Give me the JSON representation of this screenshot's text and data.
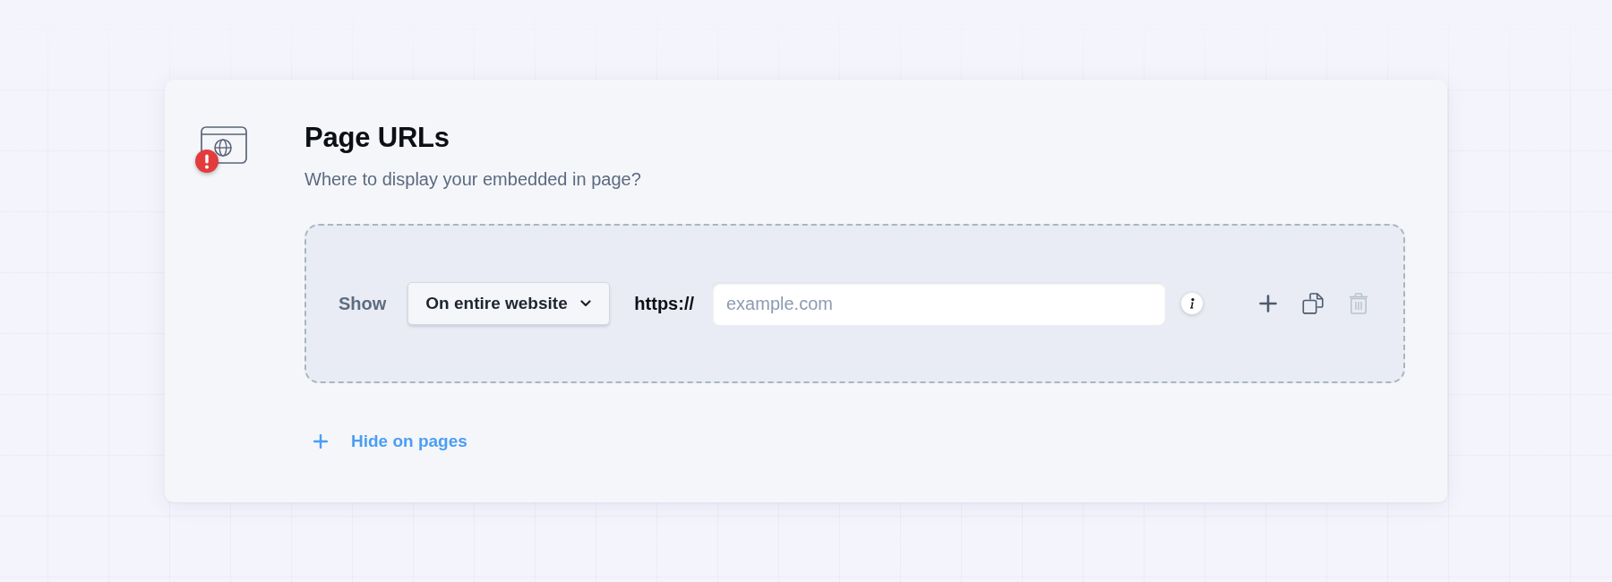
{
  "header": {
    "title": "Page URLs",
    "subtitle": "Where to display your embedded in page?",
    "alert": true
  },
  "rule": {
    "label": "Show",
    "dropdown": {
      "value": "On entire website"
    },
    "prefix": "https://",
    "url_field": {
      "placeholder": "example.com"
    },
    "actions": [
      {
        "kind": "add",
        "disabled": false
      },
      {
        "kind": "duplicate",
        "disabled": false
      },
      {
        "kind": "delete",
        "disabled": true
      }
    ]
  },
  "add_link": {
    "label": "Hide on pages"
  }
}
